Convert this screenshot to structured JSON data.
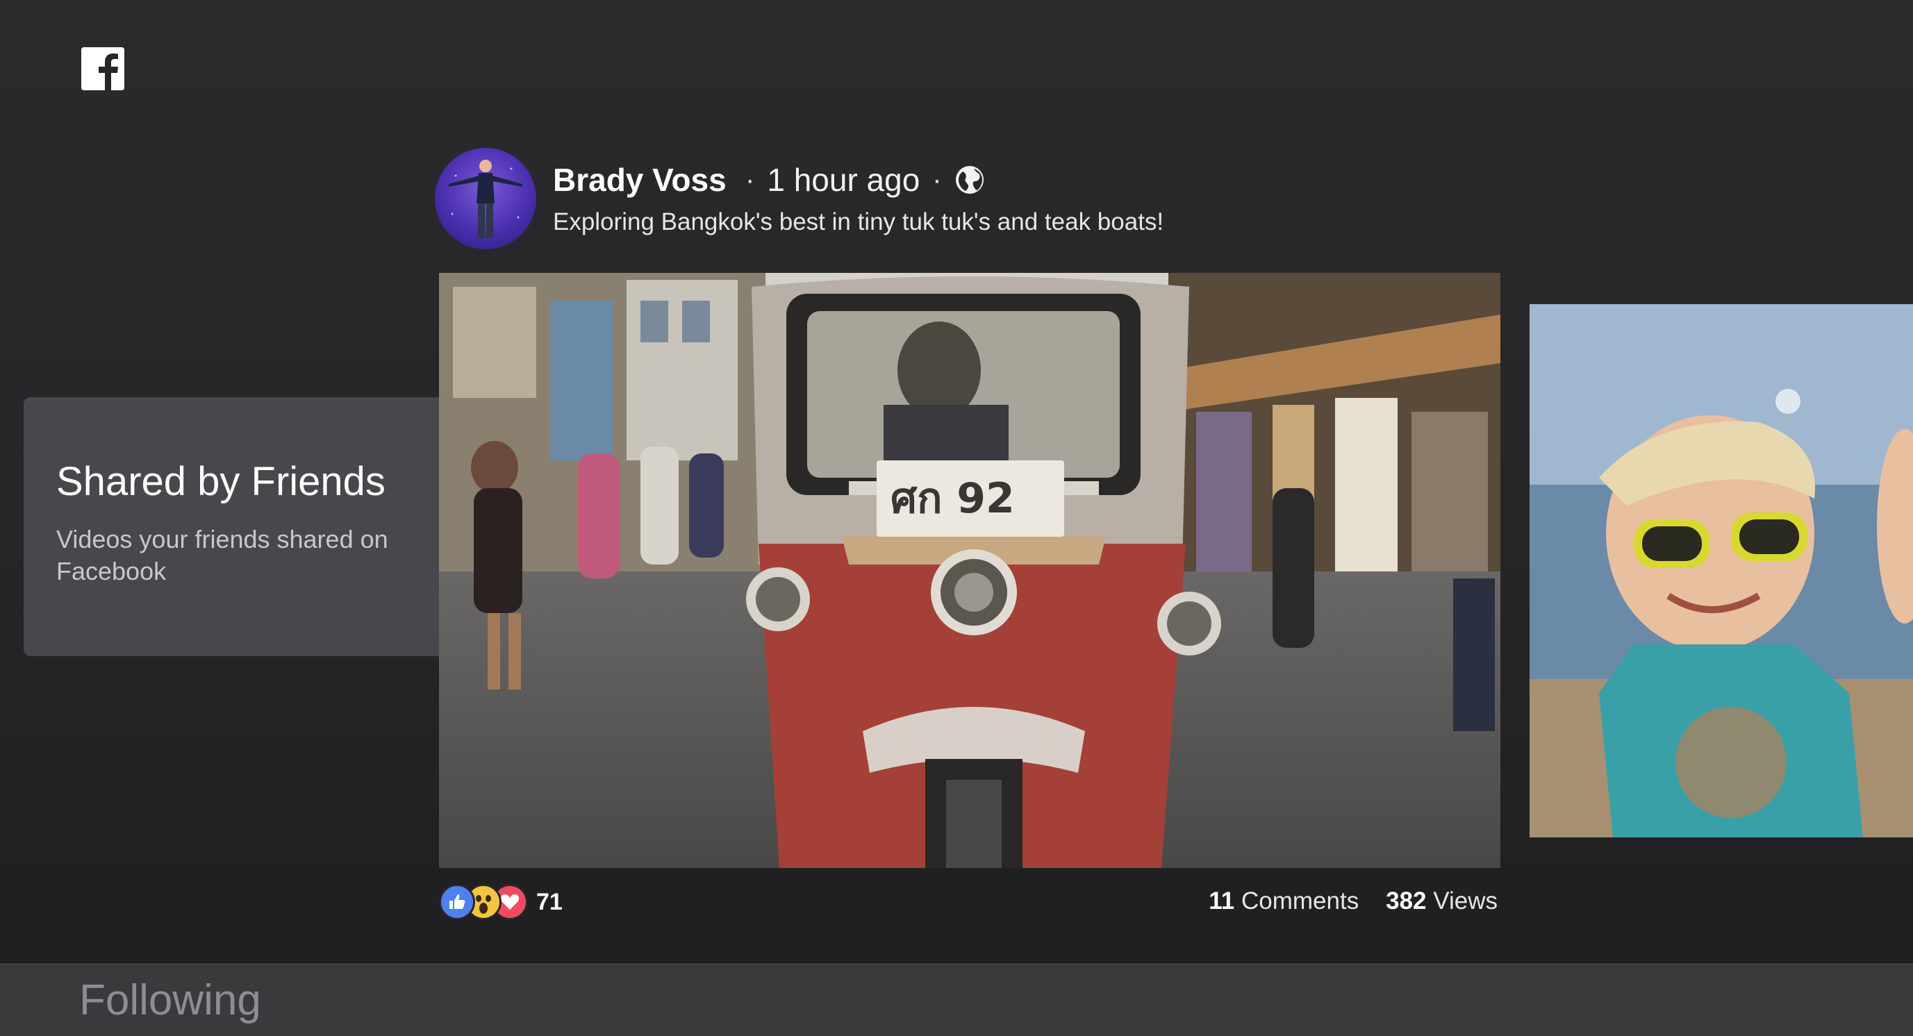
{
  "app": {
    "logo_icon": "facebook-logo-icon",
    "brand_color": "#1877f2"
  },
  "category": {
    "title": "Shared by Friends",
    "subtitle": "Videos your friends shared on Facebook"
  },
  "post": {
    "author": "Brady Voss",
    "separator": "·",
    "time": "1 hour ago",
    "privacy_icon": "globe-icon",
    "caption": "Exploring Bangkok's best in tiny tuk tuk's and teak boats!",
    "media_description_icon": "video-thumbnail",
    "reactions": {
      "icons": [
        "like-icon",
        "wow-icon",
        "love-icon"
      ],
      "count": "71"
    },
    "comments_count": "11",
    "comments_label": "Comments",
    "views_count": "382",
    "views_label": "Views"
  },
  "next_row": {
    "label": "Following"
  }
}
